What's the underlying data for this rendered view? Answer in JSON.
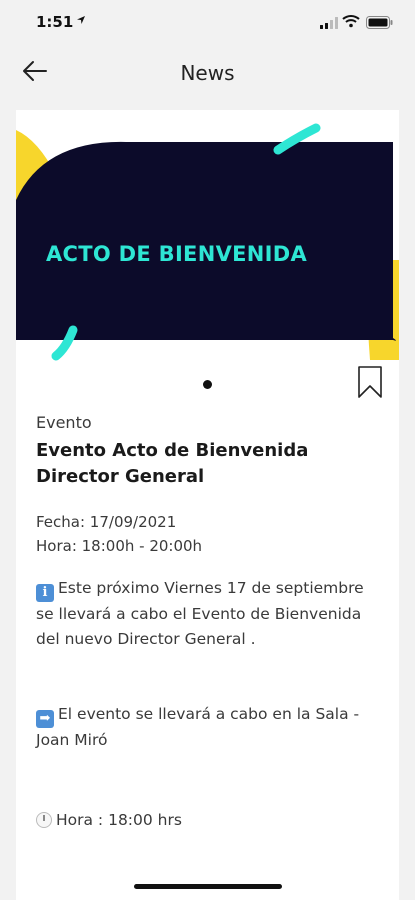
{
  "status_bar": {
    "time": "1:51",
    "location_arrow": "location-arrow-icon"
  },
  "header": {
    "title": "News",
    "back_icon": "arrow-left-icon"
  },
  "banner": {
    "title": "ACTO DE BIENVENIDA",
    "colors": {
      "background": "#0c0b2a",
      "text": "#2ee6d4",
      "accent_yellow": "#f7d62c",
      "accent_teal": "#2ee6d4"
    }
  },
  "carousel": {
    "current_page": 1,
    "total_pages": 1
  },
  "article": {
    "category": "Evento",
    "title": "Evento Acto de Bienvenida Director General",
    "date_line": "Fecha: 17/09/2021",
    "time_line": "Hora: 18:00h - 20:00h",
    "paragraph1_icon": "i",
    "paragraph1": "Este próximo Viernes 17 de septiembre se llevará a cabo el Evento de Bienvenida del nuevo Director General .",
    "paragraph2_icon": "➡",
    "paragraph2": "El evento se llevará a cabo en la Sala - Joan Miró",
    "paragraph3": "Hora : 18:00 hrs"
  }
}
